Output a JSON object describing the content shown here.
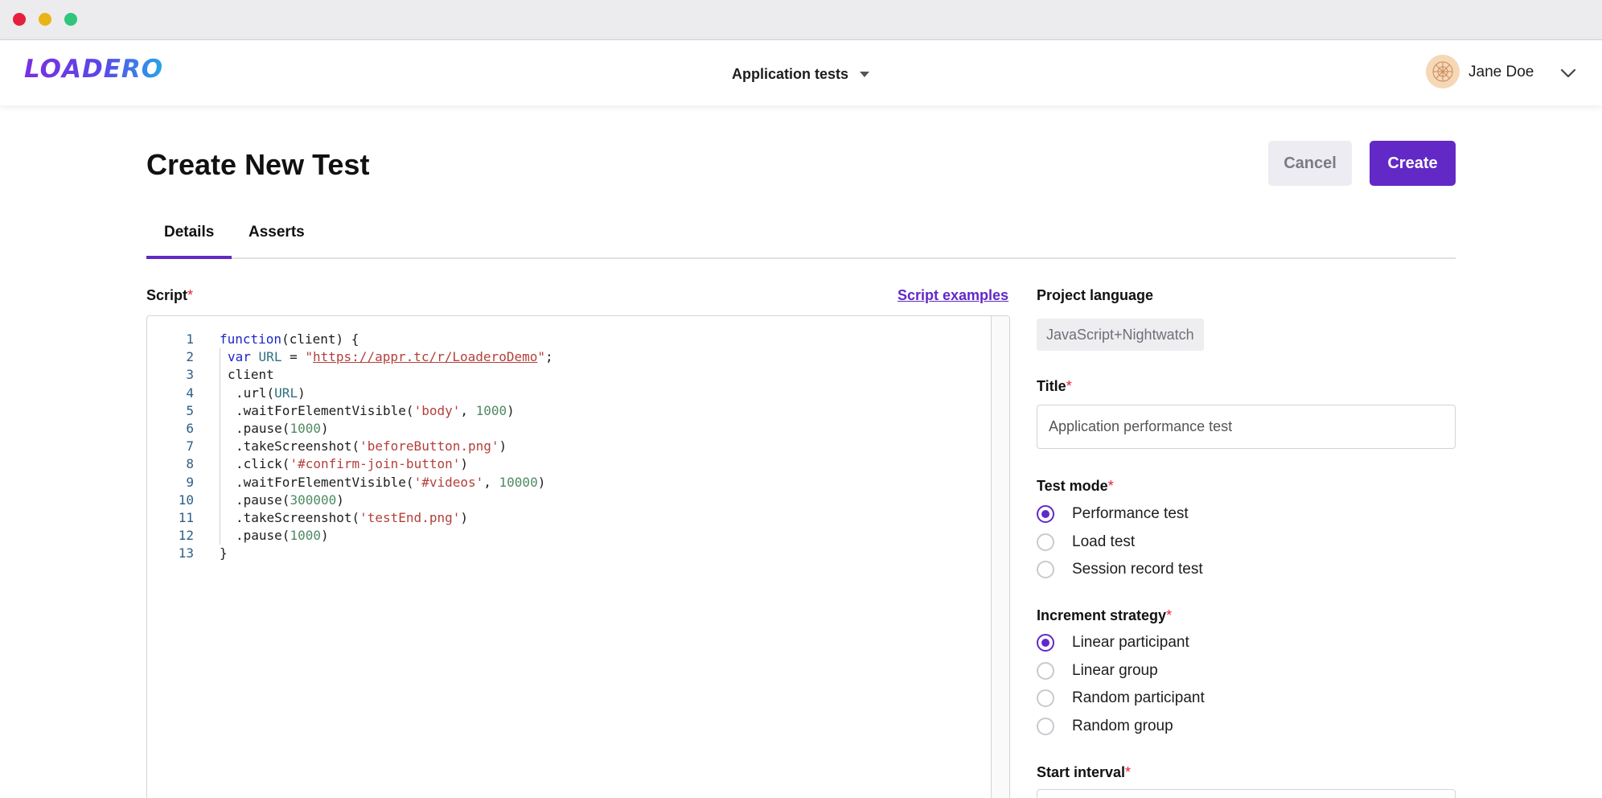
{
  "window": {
    "controls": [
      "close",
      "minimize",
      "maximize"
    ]
  },
  "header": {
    "logo_text": "LOADERO",
    "project_selector": "Application tests",
    "user_name": "Jane Doe"
  },
  "page": {
    "title": "Create New Test",
    "cancel_label": "Cancel",
    "create_label": "Create",
    "tabs": [
      {
        "label": "Details",
        "active": true
      },
      {
        "label": "Asserts",
        "active": false
      }
    ]
  },
  "script": {
    "label": "Script",
    "required_mark": "*",
    "examples_link": "Script examples",
    "line_numbers": [
      "1",
      "2",
      "3",
      "4",
      "5",
      "6",
      "7",
      "8",
      "9",
      "10",
      "11",
      "12",
      "13"
    ],
    "code_lines": [
      "function(client) {",
      "var URL = \"https://appr.tc/r/LoaderoDemo\";",
      "client",
      ".url(URL)",
      ".waitForElementVisible('body', 1000)",
      ".pause(1000)",
      ".takeScreenshot('beforeButton.png')",
      ".click('#confirm-join-button')",
      ".waitForElementVisible('#videos', 10000)",
      ".pause(300000)",
      ".takeScreenshot('testEnd.png')",
      ".pause(1000)",
      "}"
    ]
  },
  "project_language": {
    "label": "Project language",
    "value": "JavaScript+Nightwatch"
  },
  "title_field": {
    "label": "Title",
    "required_mark": "*",
    "value": "Application performance test"
  },
  "test_mode": {
    "label": "Test mode",
    "required_mark": "*",
    "options": [
      {
        "label": "Performance test",
        "checked": true
      },
      {
        "label": "Load test",
        "checked": false
      },
      {
        "label": "Session record test",
        "checked": false
      }
    ]
  },
  "increment_strategy": {
    "label": "Increment strategy",
    "required_mark": "*",
    "options": [
      {
        "label": "Linear participant",
        "checked": true
      },
      {
        "label": "Linear group",
        "checked": false
      },
      {
        "label": "Random participant",
        "checked": false
      },
      {
        "label": "Random group",
        "checked": false
      }
    ]
  },
  "start_interval": {
    "label": "Start interval",
    "required_mark": "*"
  },
  "colors": {
    "accent": "#6229c6",
    "required": "#e5203d"
  }
}
